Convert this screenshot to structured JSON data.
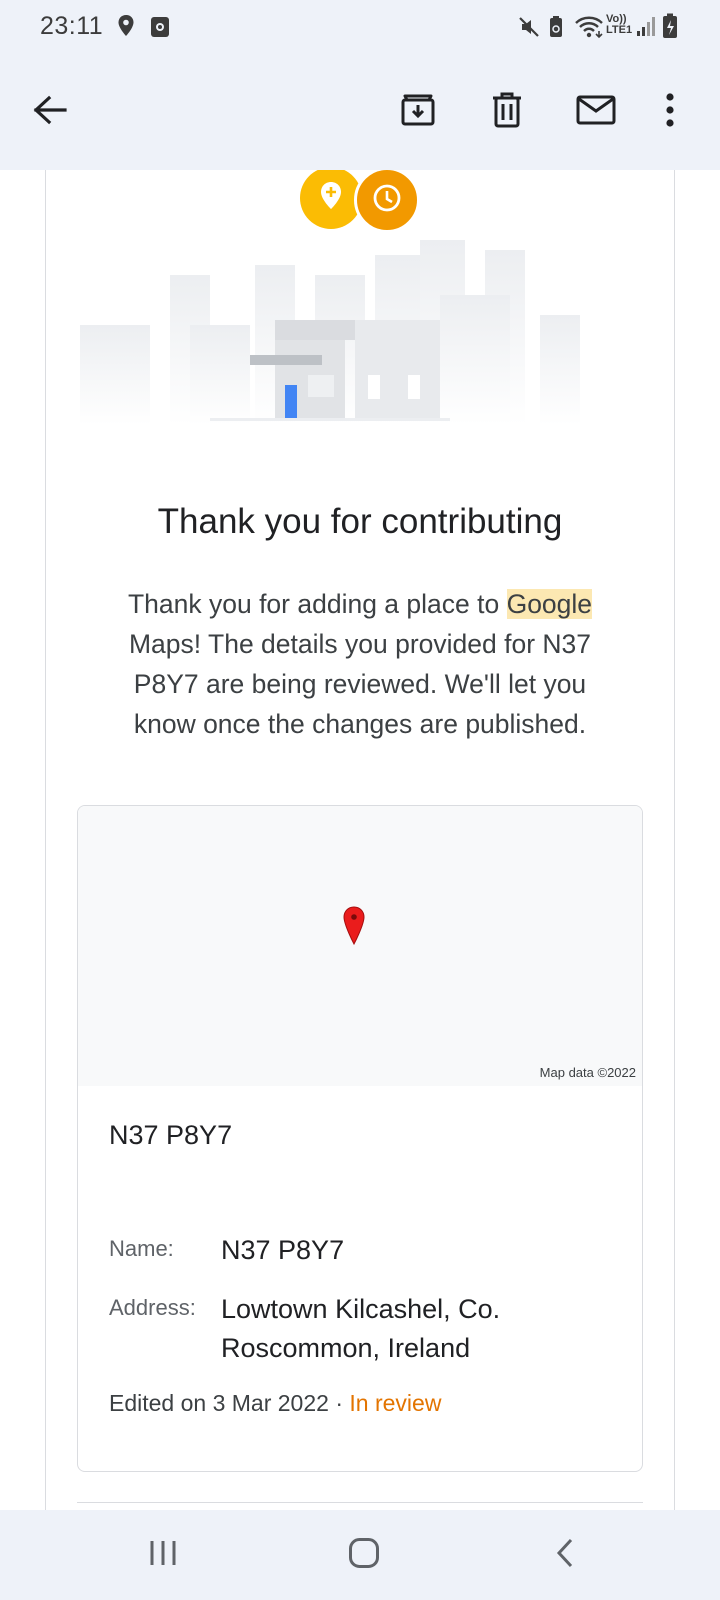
{
  "status_bar": {
    "time": "23:11",
    "left_icons": [
      "location-pin-icon",
      "screen-record-icon"
    ],
    "right_icons": [
      "mute-icon",
      "battery-saver-icon",
      "wifi-icon",
      "volte-icon",
      "signal-icon",
      "battery-icon"
    ],
    "volte_line1": "Vo))",
    "volte_line2": "LTE1"
  },
  "app_bar": {
    "actions": [
      "back-arrow-icon",
      "archive-icon",
      "delete-icon",
      "mark-unread-icon",
      "more-vert-icon"
    ]
  },
  "email": {
    "badges": [
      "add-place-pin-icon",
      "clock-icon"
    ],
    "badge_colors": {
      "pin": "#fbbc04",
      "clock": "#f29900"
    },
    "headline": "Thank you for contributing",
    "body_before": "Thank you for adding a place to ",
    "body_highlight": "Google",
    "body_after": " Maps! The details you provided for N37 P8Y7 are being reviewed. We'll let you know once the changes are published.",
    "card": {
      "map_credit": "Map data ©2022",
      "title": "N37 P8Y7",
      "name_label": "Name:",
      "name_value": "N37 P8Y7",
      "address_label": "Address:",
      "address_value": "Lowtown Kilcashel, Co. Roscommon, Ireland",
      "edited": "Edited on 3 Mar 2022",
      "separator": " · ",
      "status": "In review",
      "status_color": "#e37400"
    }
  },
  "nav_bar": {
    "buttons": [
      "recent-apps-icon",
      "home-icon",
      "back-nav-icon"
    ]
  }
}
